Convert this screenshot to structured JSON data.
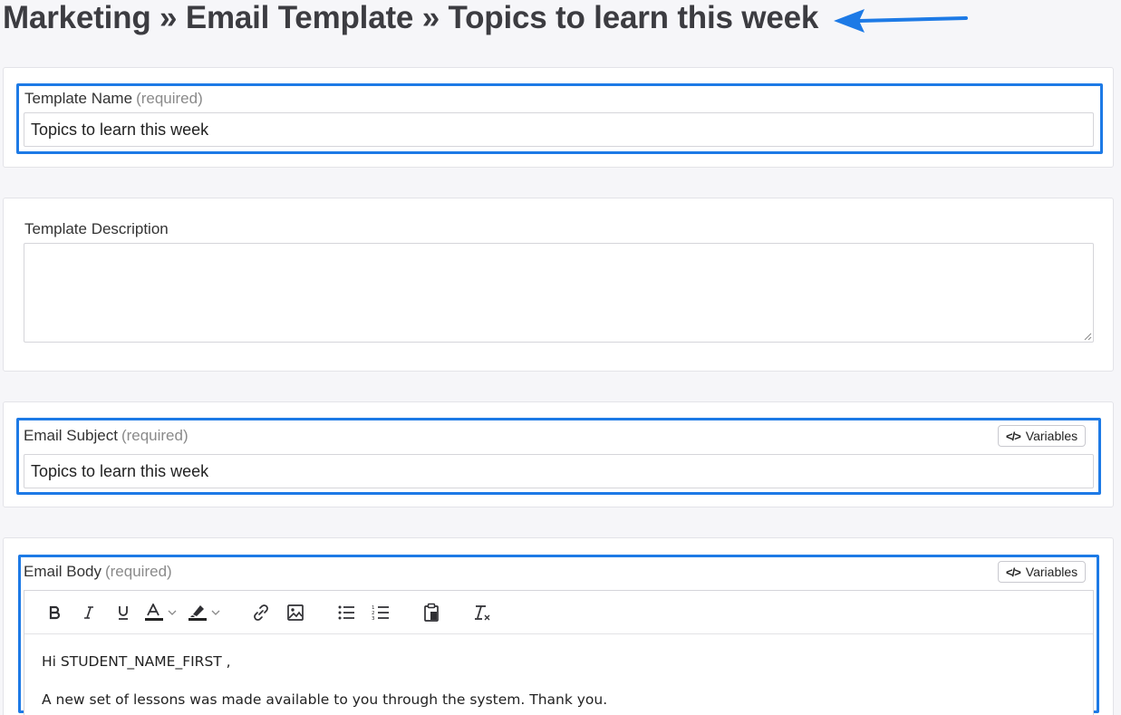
{
  "header": {
    "breadcrumb_title": "Marketing » Email Template » Topics to learn this week"
  },
  "template_name": {
    "label": "Template Name",
    "required_hint": "(required)",
    "value": "Topics to learn this week"
  },
  "template_description": {
    "label": "Template Description",
    "value": ""
  },
  "email_subject": {
    "label": "Email Subject",
    "required_hint": "(required)",
    "value": "Topics to learn this week",
    "variables_button": "Variables"
  },
  "email_body": {
    "label": "Email Body",
    "required_hint": "(required)",
    "variables_button": "Variables",
    "toolbar": [
      "bold-icon",
      "italic-icon",
      "underline-icon",
      "text-color-icon",
      "highlight-color-icon",
      "link-icon",
      "image-icon",
      "bulleted-list-icon",
      "numbered-list-icon",
      "paste-icon",
      "clear-formatting-icon"
    ],
    "content": [
      "Hi STUDENT_NAME_FIRST ,",
      "A new set of lessons was made available to you through the system. Thank you."
    ]
  },
  "colors": {
    "highlight_border": "#1d7ae6",
    "annotation_arrow": "#1d7ae6",
    "page_background": "#f6f6f9"
  }
}
